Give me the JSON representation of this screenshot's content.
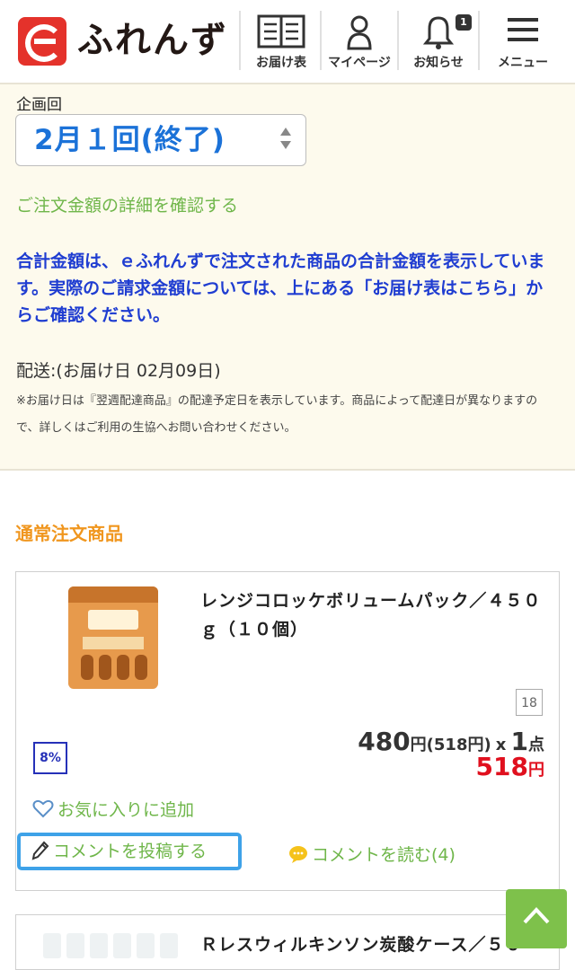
{
  "header": {
    "brand": "ふれんず",
    "nav": [
      {
        "label": "お届け表",
        "icon": "delivery-list-icon"
      },
      {
        "label": "マイページ",
        "icon": "user-icon"
      },
      {
        "label": "お知らせ",
        "icon": "bell-icon",
        "badge": "1"
      },
      {
        "label": "メニュー",
        "icon": "hamburger-menu-icon"
      }
    ]
  },
  "order": {
    "round_label": "企画回",
    "round_value": "2月１回(終了)",
    "detail_link": "ご注文金額の詳細を確認する",
    "notice": "合計金額は、ｅふれんずで注文された商品の合計金額を表示しています。実際のご請求金額については、上にある「お届け表はこちら」からご確認ください。",
    "delivery": "配送:(お届け日 02月09日)",
    "note": "※お届け日は『翌週配達商品』の配達予定日を表示しています。商品によって配達日が異なりますので、詳しくはご利用の生協へお問い合わせください。"
  },
  "section_title": "通常注文商品",
  "products": [
    {
      "name": "レンジコロッケボリュームパック／４５０ｇ（１０個）",
      "small_number": "18",
      "tax": "8%",
      "unit_price": "480",
      "unit_price_tax": "(518円)",
      "yen": "円",
      "times": "x",
      "quantity": "1",
      "count_unit": "点",
      "total_price": "518",
      "favorite_label": "お気に入りに追加",
      "post_comment_label": "コメントを投稿する",
      "read_comment_label": "コメントを読む(4)"
    },
    {
      "name": "Ｒレスウィルキンソン炭酸ケース／５０"
    }
  ],
  "colors": {
    "accent_green": "#6fb64a",
    "notice_blue": "#1f3dd1",
    "select_blue": "#1b72d8",
    "section_orange": "#f0961e",
    "price_red": "#e0101e",
    "top_bg": "#fdfaed"
  }
}
